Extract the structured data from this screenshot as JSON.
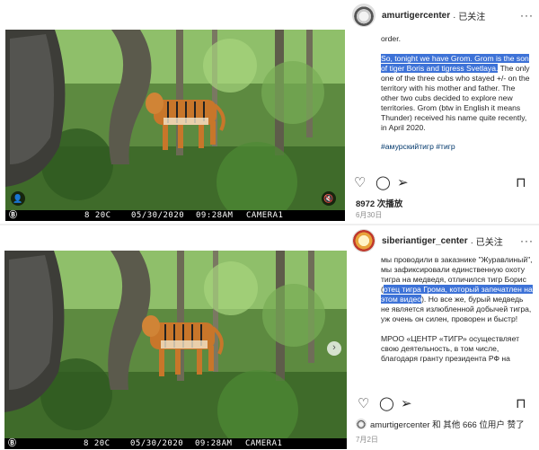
{
  "post1": {
    "username": "amurtigercenter",
    "follow_label": "· 已关注",
    "more_label": "···",
    "caption_top": "order.",
    "caption_highlight": "So, tonight we have Grom. Grom is the son of tiger Boris and tigress Svetlaya.",
    "caption_rest": "The only one of the three cubs who stayed +/- on the territory with his mother and father. The other two cubs decided to explore new territories. Grom (btw in English it means Thunder) received his name quite recently, in April 2020.",
    "hashtags": "#амурскийтигр #тигр",
    "views": "8972 次播放",
    "date": "6月30日",
    "camera": {
      "logo": "Ⓑ",
      "temp": "8 20C",
      "date": "05/30/2020",
      "time": "09:28AM",
      "cam": "CAMERA1"
    }
  },
  "post2": {
    "username": "siberiantiger_center",
    "follow_label": "· 已关注",
    "more_label": "···",
    "caption_top": "мы проводили в заказнике \"Журавлиный\", мы зафиксировали единственную охоту тигра на медведя, отличился тигр Борис (",
    "caption_highlight": "отец тигра Грома, который запечатлен на этом видео",
    "caption_rest": "). Но все же, бурый медведь не является излюбленной добычей тигра, уж очень он силен, проворен и быстр!",
    "caption_para2": "МРОО «ЦЕНТР «ТИГР» осуществляет свою деятельность, в том числе, благодаря гранту президента РФ на",
    "liked_by": "amurtigercenter 和 其他 666 位用户 赞了",
    "date": "7月2日",
    "camera": {
      "logo": "Ⓑ",
      "temp": "8 20C",
      "date": "05/30/2020",
      "time": "09:28AM",
      "cam": "CAMERA1"
    }
  },
  "icons": {
    "heart": "♡",
    "comment": "◯",
    "share": "➢",
    "bookmark": "⊓",
    "mute": "🔇",
    "user": "👤",
    "next": "›"
  }
}
